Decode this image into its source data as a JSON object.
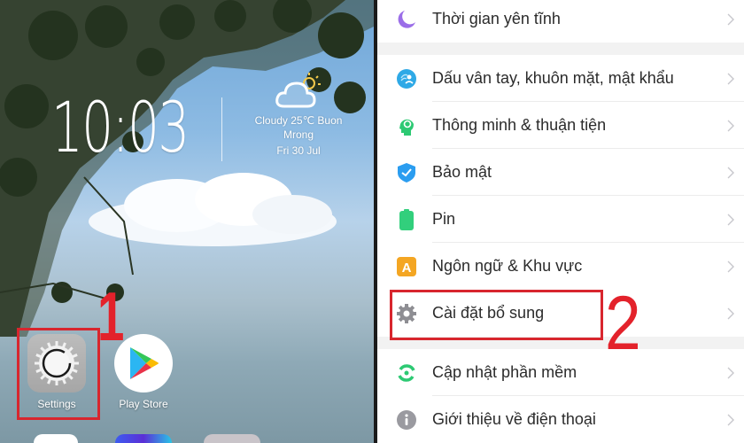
{
  "home_screen": {
    "clock": {
      "time": "10:03"
    },
    "weather": {
      "icon": "cloudy-sun-icon",
      "condition_line": "Cloudy 25℃   Buon",
      "location_line": "Mrong",
      "date": "Fri 30 Jul"
    },
    "apps": [
      {
        "label": "Settings",
        "icon": "settings-gear-icon"
      },
      {
        "label": "Play Store",
        "icon": "play-store-icon"
      }
    ]
  },
  "settings_list": {
    "items": [
      {
        "label": "Thời gian yên tĩnh",
        "icon": "moon-icon",
        "color": "#9b6ee8"
      },
      {
        "label": "Dấu vân tay, khuôn mặt, mật khẩu",
        "icon": "fingerprint-face-icon",
        "color": "#2fa9e6"
      },
      {
        "label": "Thông minh & thuận tiện",
        "icon": "smart-head-icon",
        "color": "#2dc973"
      },
      {
        "label": "Bảo mật",
        "icon": "shield-check-icon",
        "color": "#2b9df0"
      },
      {
        "label": "Pin",
        "icon": "battery-icon",
        "color": "#32cf7c"
      },
      {
        "label": "Ngôn ngữ & Khu vực",
        "icon": "language-icon",
        "color": "#f4a623"
      },
      {
        "label": "Cài đặt bổ sung",
        "icon": "gear-icon",
        "color": "#8e8e93"
      },
      {
        "label": "Cập nhật phần mềm",
        "icon": "software-update-icon",
        "color": "#2dc973"
      },
      {
        "label": "Giới thiệu về điện thoại",
        "icon": "info-icon",
        "color": "#9a9aa0"
      }
    ]
  },
  "annotations": {
    "step1": "1",
    "step2": "2",
    "highlight_color": "#d8262e"
  }
}
